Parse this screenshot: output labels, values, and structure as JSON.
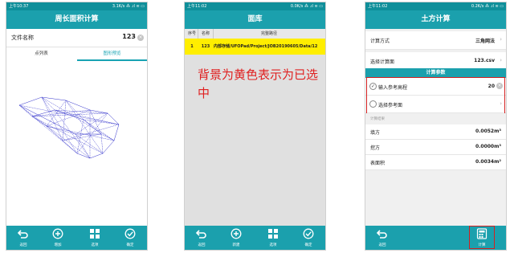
{
  "phone1": {
    "status": {
      "time": "上午10:37",
      "right": "3.1K/s ⁂ .ıl ≋ ▭"
    },
    "title": "周长面积计算",
    "file_label": "文件名称",
    "file_value": "123",
    "tabs": [
      {
        "label": "点列表",
        "active": false
      },
      {
        "label": "图形预览",
        "active": true
      }
    ],
    "bottom": [
      {
        "label": "返回",
        "icon": "undo-icon"
      },
      {
        "label": "增加",
        "icon": "add-circle-icon"
      },
      {
        "label": "选项",
        "icon": "grid-icon"
      },
      {
        "label": "确定",
        "icon": "check-circle-icon"
      }
    ]
  },
  "phone2": {
    "status": {
      "time": "上午11:02",
      "right": "0.0K/s ⁂ .ıl ≋ ▭"
    },
    "title": "面库",
    "table": {
      "columns": [
        "序号",
        "名称",
        "完整路径"
      ],
      "rows": [
        {
          "no": "1",
          "name": "123",
          "path": "内部存储/UFOPad/Project/JOB20190605/Data/12",
          "selected": true
        }
      ]
    },
    "annotation": "背景为黄色表示为已选中",
    "bottom": [
      {
        "label": "返回",
        "icon": "undo-icon"
      },
      {
        "label": "新建",
        "icon": "add-circle-icon"
      },
      {
        "label": "选项",
        "icon": "grid-icon"
      },
      {
        "label": "确定",
        "icon": "check-circle-icon"
      }
    ]
  },
  "phone3": {
    "status": {
      "time": "上午11:02",
      "right": "0.2K/s ⁂ .ıl ≋ ▭"
    },
    "title": "土方计算",
    "calc_method": {
      "label": "计算方式",
      "value": "三角网法"
    },
    "select_face": {
      "label": "选择计算面",
      "value": "123.csv"
    },
    "param_title": "计算参数",
    "ref_elev": {
      "label": "输入参考高程",
      "value": "20",
      "checked": true
    },
    "ref_face": {
      "label": "选择参考面",
      "checked": false
    },
    "result_caption": "计算结果",
    "results": [
      {
        "label": "填方",
        "value": "0.0052m³"
      },
      {
        "label": "挖方",
        "value": "0.0000m³"
      },
      {
        "label": "表面积",
        "value": "0.0034m²"
      }
    ],
    "bottom": [
      {
        "label": "返回",
        "icon": "undo-icon"
      },
      {
        "label": "计算",
        "icon": "calculator-icon"
      }
    ]
  },
  "colors": {
    "teal": "#1ba0ad",
    "teal_dark": "#0f8f9a",
    "selected_row": "#ffee00",
    "annotation": "#e02020",
    "highlight_border": "#d42020",
    "preview_lines": "#3333cc"
  }
}
